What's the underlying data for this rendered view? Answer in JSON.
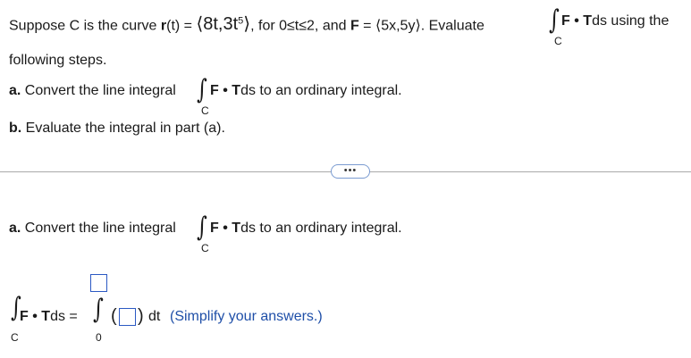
{
  "question": {
    "intro_1": "Suppose C is the curve ",
    "r_bold": "r",
    "r_eq": "(t) = ",
    "r_vector": "⟨8t,3t",
    "exp5": "5",
    "r_close": "⟩",
    "range": ", for 0≤t≤2, and ",
    "F_bold": "F",
    "F_eq": " = ⟨5x,5y⟩",
    "evaluate": ". Evaluate",
    "integral_symbol": "∫",
    "sub_C": "C",
    "F_dot_T_F": "F",
    "dot": " • ",
    "F_dot_T_T": "T",
    "ds": "ds",
    "using_the": " using the",
    "following_steps": "following steps.",
    "part_a_label": "a.",
    "part_a_text": " Convert the line integral",
    "part_a_end": " to an ordinary integral.",
    "part_b_label": "b.",
    "part_b_text": " Evaluate the integral in part (a)."
  },
  "more_button": "•••",
  "work": {
    "part_a_label": "a.",
    "part_a_text": " Convert the line integral",
    "part_a_end": " to an ordinary integral.",
    "lhs_ds": "ds =",
    "lower_limit": "0",
    "dt": " dt",
    "simplify_hint": " (Simplify your answers.)",
    "upper_limit_value": "",
    "integrand_value": ""
  }
}
